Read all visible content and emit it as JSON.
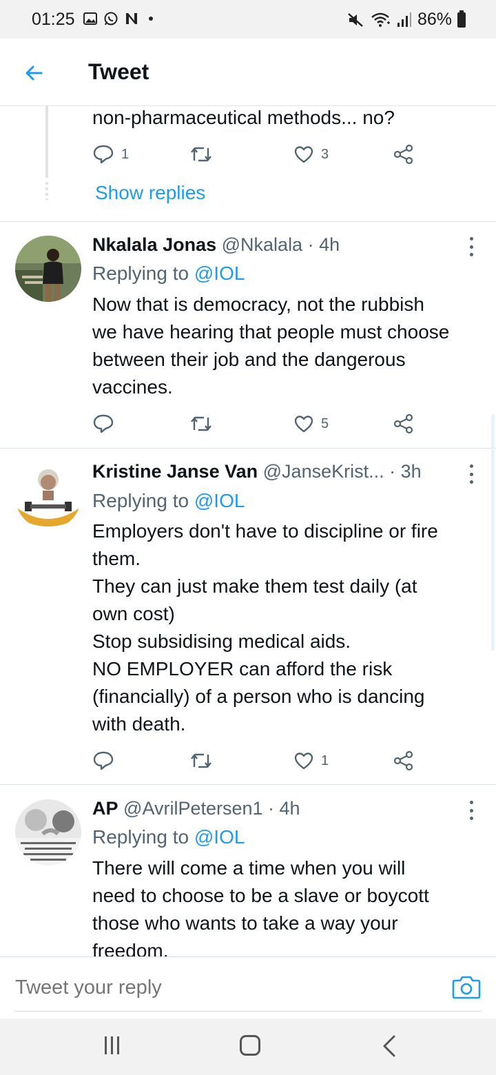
{
  "status_bar": {
    "time": "01:25",
    "battery": "86%"
  },
  "header": {
    "title": "Tweet"
  },
  "previous_tweet": {
    "text_tail": "non-pharmaceutical methods... no?",
    "replies": "1",
    "likes": "3",
    "show_replies": "Show replies"
  },
  "tweets": [
    {
      "name": "Nkalala Jonas",
      "handle": "@Nkalala",
      "time": "· 4h",
      "replying_prefix": "Replying to ",
      "replying_to": "@IOL",
      "lines": [
        "Now that is democracy, not the rubbish",
        "we have hearing that people must choose",
        "between their job and the dangerous",
        "vaccines."
      ],
      "likes": "5"
    },
    {
      "name": "Kristine Janse Van",
      "handle": "@JanseKrist...",
      "time": "· 3h",
      "replying_prefix": "Replying to ",
      "replying_to": "@IOL",
      "lines": [
        "Employers don't have to discipline or fire",
        "them.",
        "They can just make them test daily (at",
        "own cost)",
        "Stop subsidising medical aids.",
        "NO EMPLOYER can afford the risk",
        "(financially) of a person who is dancing",
        "with death."
      ],
      "likes": "1",
      "avatar_caption": "I AM VACCINATED"
    },
    {
      "name": "AP",
      "handle": "@AvrilPetersen1",
      "time": "· 4h",
      "replying_prefix": "Replying to ",
      "replying_to": "@IOL",
      "lines": [
        "There will come a time when you will",
        "need to choose to be a slave or boycott",
        "those who wants to take a way your",
        "freedom."
      ],
      "avatar_caption": "God chose the color of your skin. You choose the color of your character"
    }
  ],
  "composer": {
    "placeholder": "Tweet your reply"
  },
  "icons": {
    "back": "arrow-left-icon",
    "reply": "speech-bubble-icon",
    "retweet": "retweet-icon",
    "like": "heart-icon",
    "share": "share-icon",
    "camera": "camera-icon",
    "more": "vertical-ellipsis-icon"
  },
  "colors": {
    "accent": "#1d9bf0",
    "text": "#0f1419",
    "secondary": "#536471"
  }
}
